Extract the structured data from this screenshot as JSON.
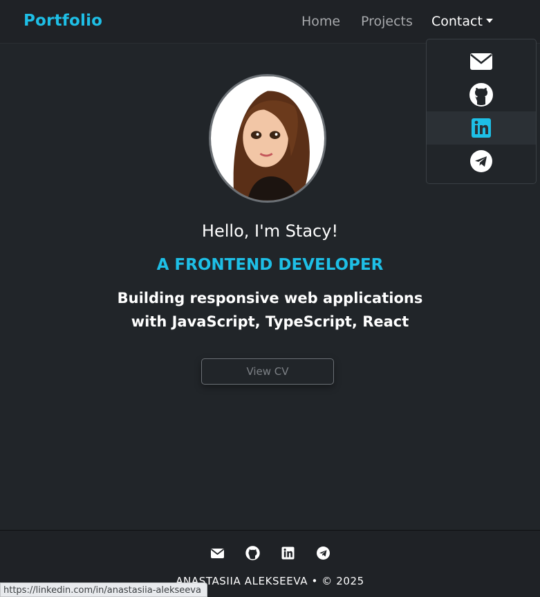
{
  "navbar": {
    "brand": "Portfolio",
    "links": [
      {
        "label": "Home"
      },
      {
        "label": "Projects"
      },
      {
        "label": "Contact"
      }
    ]
  },
  "dropdown": {
    "items": [
      {
        "icon": "envelope-icon"
      },
      {
        "icon": "github-icon"
      },
      {
        "icon": "linkedin-icon",
        "active": true
      },
      {
        "icon": "telegram-icon"
      }
    ]
  },
  "hero": {
    "greeting": "Hello, I'm Stacy!",
    "role": "A FRONTEND DEVELOPER",
    "tagline_line1": "Building responsive web applications",
    "tagline_line2": "with JavaScript, TypeScript, React",
    "cv_button": "View CV"
  },
  "footer": {
    "icons": [
      "envelope-icon",
      "github-icon",
      "linkedin-icon",
      "telegram-icon"
    ],
    "copyright": "ANASTASIIA ALEKSEEVA • © 2025"
  },
  "status_bar": {
    "url": "https://linkedin.com/in/anastasiia-alekseeva"
  },
  "colors": {
    "background": "#212529",
    "accent": "#1ebfe6",
    "muted_text": "#a7a9ac"
  }
}
